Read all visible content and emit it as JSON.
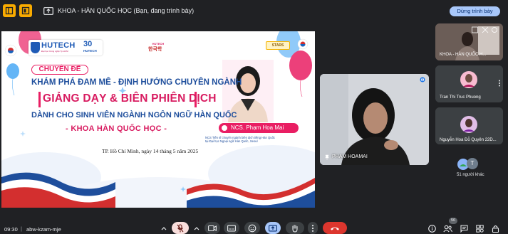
{
  "topbar": {
    "share_text": "KHOA - HÀN QUỐC HỌC (Bạn, đang trình bày)",
    "stop_button": "Dừng trình bày"
  },
  "slide": {
    "logo_hutech": "HUTECH",
    "logo_sub": "Đại học Công nghệ Tp.HCM",
    "logo_30": "30",
    "logo_30_sub": "HUTECH",
    "stars": "STARS",
    "chuyen_de": "CHUYÊN ĐỀ",
    "title1": "KHÁM PHÁ ĐAM MÊ - ĐỊNH HƯỚNG CHUYÊN NGÀNH",
    "title2": "GIẢNG DẠY & BIÊN PHIÊN DỊCH",
    "title3": "DÀNH CHO SINH VIÊN NGÀNH NGÔN NGỮ HÀN QUỐC",
    "title4": "- KHOA HÀN QUỐC HỌC -",
    "date": "TP. Hồ Chí Minh, ngày 14 tháng 5 năm 2025",
    "speaker_name": "NCS. Phạm Hoa Mai",
    "speaker_desc_1": "NCS Tiến sĩ chuyên ngành biên dịch tiếng Hàn Quốc",
    "speaker_desc_2": "tại Đại học Ngoại ngữ Hàn Quốc, Seoul"
  },
  "participants": {
    "main_name": "PHAM HOAMAI",
    "tiles": [
      {
        "label": "KHOA - HÀN QUỐC H..."
      },
      {
        "label": "Tran Thi Truc Phuong"
      },
      {
        "label": "Nguyễn Hoa Đỗ Quyên 22D..."
      }
    ],
    "others_initial": "T",
    "others_label": "51 người khác",
    "count": "56"
  },
  "bottombar": {
    "time": "09:30",
    "divider": "|",
    "meeting_code": "abw-kzam-mje"
  },
  "colors": {
    "accent": "#a8c7fa",
    "end_call": "#dc362e",
    "mic_off": "#f9dedc",
    "present_active": "#a8c7fa",
    "slide_blue": "#1e4e9c",
    "slide_pink": "#d81b60"
  },
  "icons": [
    "panel-icon",
    "chat-icon",
    "present-icon",
    "mic-off-icon",
    "camera-icon",
    "captions-icon",
    "emoji-icon",
    "raise-hand-icon",
    "more-icon",
    "end-call-icon",
    "info-icon",
    "people-icon",
    "activities-icon",
    "lock-icon"
  ]
}
